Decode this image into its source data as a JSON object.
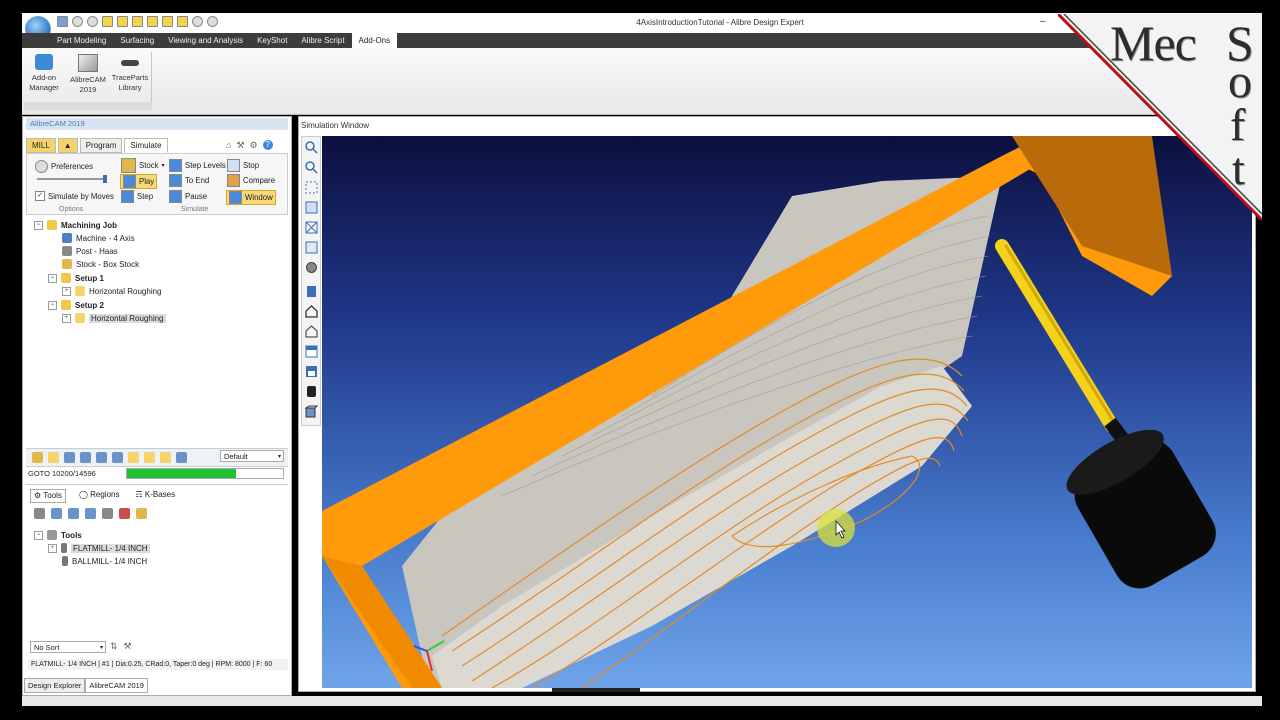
{
  "window": {
    "title": "4AxisIntroductionTutorial - Alibre Design Expert"
  },
  "ribbon_tabs": [
    {
      "label": "Part Modeling",
      "active": false
    },
    {
      "label": "Surfacing",
      "active": false
    },
    {
      "label": "Viewing and Analysis",
      "active": false
    },
    {
      "label": "KeyShot",
      "active": false
    },
    {
      "label": "Alibre Script",
      "active": false
    },
    {
      "label": "Add-Ons",
      "active": true
    }
  ],
  "ribbon": {
    "addon_manager": "Add-on\nManager",
    "addon_manager_l1": "Add-on",
    "addon_manager_l2": "Manager",
    "alibrecam_l1": "AlibreCAM",
    "alibrecam_l2": "2019",
    "traceparts_l1": "TraceParts",
    "traceparts_l2": "Library"
  },
  "panel": {
    "title": "AlibreCAM 2019",
    "tabs": {
      "mill": "MILL",
      "program": "Program",
      "simulate": "Simulate"
    },
    "sim": {
      "preferences": "Preferences",
      "simulate_by_moves": "Simulate by Moves",
      "options_group": "Options",
      "stock": "Stock",
      "play": "Play",
      "step": "Step",
      "step_levels": "Step Levels",
      "to_end": "To End",
      "pause": "Pause",
      "stop": "Stop",
      "compare": "Compare",
      "window": "Window",
      "simulate_group": "Simulate"
    },
    "tree": {
      "job": "Machining Job",
      "machine": "Machine - 4 Axis",
      "post": "Post - Haas",
      "stock": "Stock - Box Stock",
      "setup1": "Setup 1",
      "setup1_op": "Horizontal Roughing",
      "setup2": "Setup 2",
      "setup2_op": "Horizontal Roughing"
    },
    "dropdown_default": "Default",
    "goto": "GOTO 10200/14596",
    "progress": 0.7,
    "tools_tabs": {
      "tools": "Tools",
      "regions": "Regions",
      "kbases": "K-Bases"
    },
    "tools_tree": {
      "root": "Tools",
      "t1": "FLATMILL- 1/4 INCH",
      "t2": "BALLMILL- 1/4 INCH"
    },
    "sort": "No Sort",
    "status": "FLATMILL- 1/4 INCH | #1 | Dia:0.25, CRad:0, Taper:0 deg | RPM: 8000 | F: 60"
  },
  "bottom_tabs": [
    {
      "label": "Design Explorer",
      "active": false
    },
    {
      "label": "AlibreCAM 2019",
      "active": true
    }
  ],
  "sim_window": {
    "title": "Simulation Window",
    "close": "×"
  },
  "watermark": {
    "l1": "Mec",
    "l2": "S",
    "l3": "o",
    "l4": "f",
    "l5": "t"
  },
  "colors": {
    "fixture": "#ff9a0a",
    "tool_shank": "#f4d21a",
    "tool_holder": "#0a0a0a",
    "progress": "#1fc233"
  }
}
